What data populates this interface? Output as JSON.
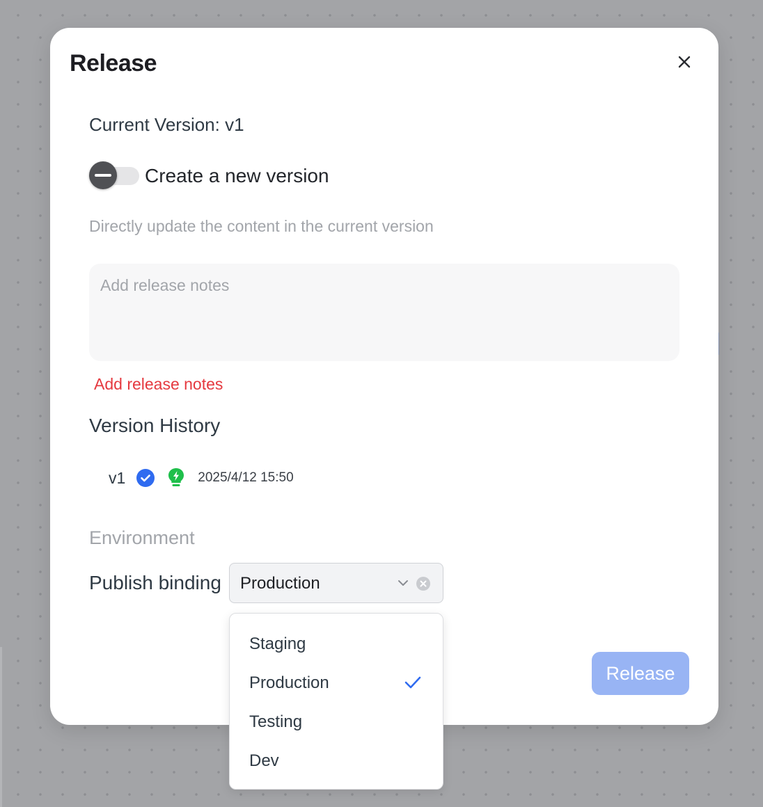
{
  "modal": {
    "title": "Release",
    "current_version_label": "Current Version: v1",
    "toggle": {
      "label": "Create a new version",
      "checked": false
    },
    "hint": "Directly update the content in the current version",
    "release_notes": {
      "placeholder": "Add release notes",
      "value": "",
      "error": "Add release notes"
    },
    "version_history": {
      "title": "Version History",
      "items": [
        {
          "version": "v1",
          "datetime": "2025/4/12 15:50",
          "verified_icon": "check-circle-icon",
          "status_icon": "lightbulb-bolt-icon"
        }
      ]
    },
    "environment": {
      "title": "Environment",
      "publish_binding_label": "Publish binding",
      "selected": "Production",
      "options": [
        "Staging",
        "Production",
        "Testing",
        "Dev"
      ]
    },
    "release_button": "Release"
  },
  "colors": {
    "primary_blue": "#2f6bf0",
    "disabled_button": "#98b4f4",
    "error_red": "#e5393f",
    "success_green": "#1fbf4b",
    "backdrop": "#a3a4a7"
  }
}
